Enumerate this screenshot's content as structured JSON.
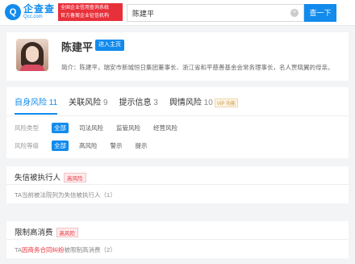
{
  "header": {
    "logo_name": "企查查",
    "logo_domain": "Qcc.com",
    "banner_lines": [
      "全国企业信用查询系统",
      "官方备案企业征信机构"
    ],
    "search_value": "陈建平",
    "search_button": "查一下"
  },
  "profile": {
    "name": "陈建平",
    "tag": "进入主页",
    "intro": "简介：陈建平，瑞安市新城恒日集团董事长、浙江省和平慈善基金会常务理事长，名人贾晓翼的母亲。"
  },
  "risk": {
    "tabs": [
      {
        "label": "自身风险",
        "count": "11"
      },
      {
        "label": "关联风险",
        "count": "9"
      },
      {
        "label": "提示信息",
        "count": "3"
      },
      {
        "label": "舆情风险",
        "count": "10"
      }
    ],
    "vip_badge": "VIP 功能",
    "filter_type_label": "风险类型",
    "filter_type_options": [
      "全部",
      "司法风险",
      "监管风险",
      "经营风险"
    ],
    "filter_level_label": "风险等级",
    "filter_level_options": [
      "全部",
      "高风险",
      "警示",
      "提示"
    ]
  },
  "sections": [
    {
      "title": "失信被执行人",
      "badge": "高风险",
      "body": "TA当前被法院列为失信被执行人（1）"
    },
    {
      "title": "限制高消费",
      "badge": "高风险",
      "body_prefix": "TA",
      "body_highlight": "因商务合同纠纷",
      "body_suffix": "被限制高消费（2）"
    }
  ],
  "colors": {
    "accent": "#128bed",
    "danger": "#e8303b"
  }
}
